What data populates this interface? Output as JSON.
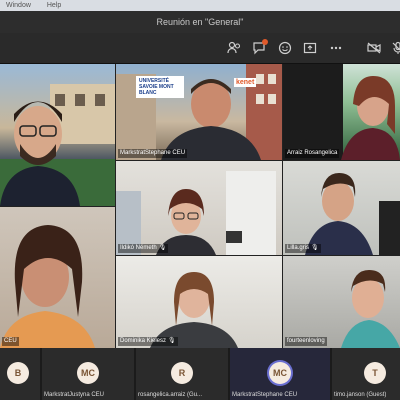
{
  "menubar": {
    "items": [
      "Window",
      "Help"
    ]
  },
  "window": {
    "title": "Reunión en \"General\""
  },
  "toolbar": {
    "icons": [
      "participants-icon",
      "chat-icon",
      "reactions-icon",
      "share-icon",
      "more-icon",
      "camera-off-icon",
      "mic-off-icon"
    ]
  },
  "video_tiles": [
    {
      "name": ""
    },
    {
      "name": "MarkstratStephane CEU",
      "sign_text": "UNIVERSITÉ SAVOIE MONT BLANC",
      "sign2_text": "kenet"
    },
    {
      "name": "Arraiz Rosangelica"
    },
    {
      "name": ""
    },
    {
      "name": ""
    },
    {
      "name": "Ildikó Németh"
    },
    {
      "name": "Lilla.gris"
    },
    {
      "name": "CEU"
    },
    {
      "name": "Dominika Kielesz"
    },
    {
      "name": "fourteenloving"
    }
  ],
  "bottom_participants": [
    {
      "initials": "B",
      "name": ""
    },
    {
      "initials": "MC",
      "name": "MarkstratJustyna CEU"
    },
    {
      "initials": "R",
      "name": "rosangelica.arraiz (Gu..."
    },
    {
      "initials": "MC",
      "name": "MarkstratStephane CEU",
      "active": true
    },
    {
      "initials": "T",
      "name": "timo.janson (Guest)"
    }
  ],
  "colors": {
    "accent": "#6a6fd1",
    "badge": "#e05a2b",
    "avatar_bg": "#f5ebe0"
  }
}
